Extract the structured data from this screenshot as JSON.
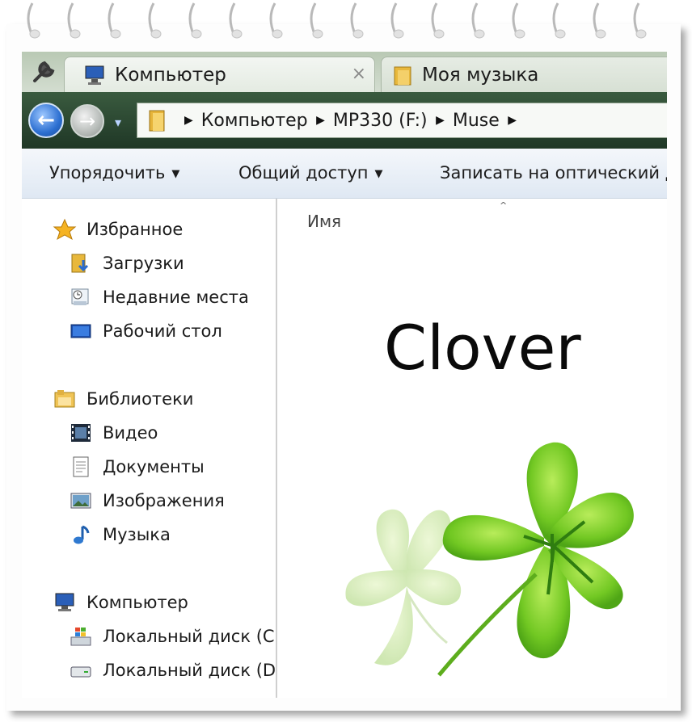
{
  "tabs": [
    {
      "label": "Компьютер",
      "icon": "computer-icon",
      "close": "×"
    },
    {
      "label": "Моя музыка",
      "icon": "folder-icon"
    }
  ],
  "toolbar": {
    "tools_icon": "wrench-icon"
  },
  "navigation": {
    "back_icon": "back-arrow-icon",
    "forward_icon": "forward-arrow-icon",
    "back_glyph": "←",
    "forward_glyph": "→",
    "dropdown_glyph": "▾"
  },
  "breadcrumb": [
    {
      "label": "Компьютер"
    },
    {
      "label": "MP330 (F:)"
    },
    {
      "label": "Muse"
    }
  ],
  "commands": {
    "organize": "Упорядочить",
    "share": "Общий доступ",
    "burn": "Записать на оптический д"
  },
  "sidebar": {
    "favorites": {
      "label": "Избранное",
      "items": [
        {
          "label": "Загрузки",
          "icon": "downloads-icon"
        },
        {
          "label": "Недавние места",
          "icon": "recent-places-icon"
        },
        {
          "label": "Рабочий стол",
          "icon": "desktop-icon"
        }
      ]
    },
    "libraries": {
      "label": "Библиотеки",
      "items": [
        {
          "label": "Видео",
          "icon": "video-icon"
        },
        {
          "label": "Документы",
          "icon": "documents-icon"
        },
        {
          "label": "Изображения",
          "icon": "pictures-icon"
        },
        {
          "label": "Музыка",
          "icon": "music-icon"
        }
      ]
    },
    "computer": {
      "label": "Компьютер",
      "items": [
        {
          "label": "Локальный диск (C",
          "icon": "windows-drive-icon"
        },
        {
          "label": "Локальный диск (D",
          "icon": "drive-icon"
        }
      ]
    }
  },
  "content": {
    "column_header": "Имя",
    "sort_indicator": "^",
    "logo_text": "Clover"
  },
  "colors": {
    "accent_green": "#6cc21e",
    "nav_blue": "#2c6fd1"
  }
}
